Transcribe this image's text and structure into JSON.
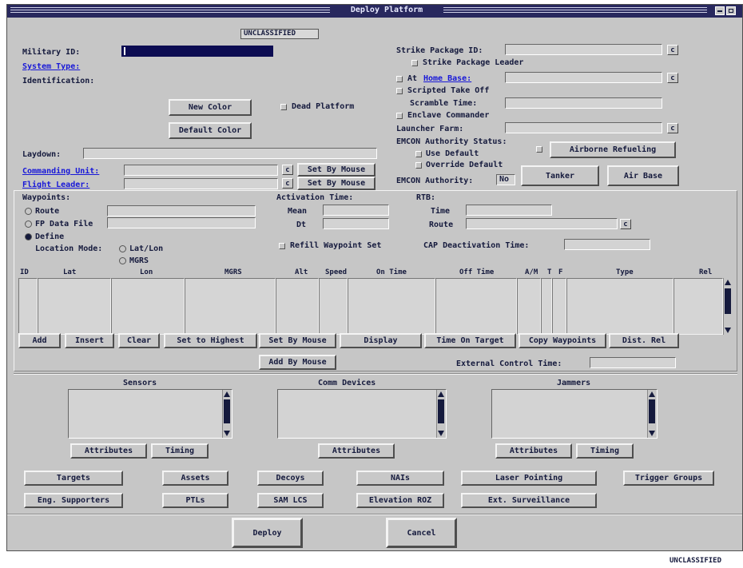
{
  "window": {
    "title": "Deploy Platform",
    "classification_top": "UNCLASSIFIED",
    "classification_bottom": "UNCLASSIFIED",
    "title_bar_color": "#28285e"
  },
  "left_top": {
    "military_id_label": "Military ID:",
    "system_type_label": "System Type:",
    "identification_label": "Identification:",
    "new_color": "New Color",
    "default_color": "Default Color",
    "dead_platform": "Dead Platform",
    "laydown_label": "Laydown:",
    "commanding_unit_label": "Commanding Unit:",
    "flight_leader_label": "Flight Leader:",
    "set_by_mouse_1": "Set By Mouse",
    "set_by_mouse_2": "Set By Mouse",
    "c_btn": "c"
  },
  "right_top": {
    "strike_package_id": "Strike Package ID:",
    "strike_package_leader": "Strike Package Leader",
    "at_label": "At",
    "home_base": "Home Base:",
    "scripted_take_off": "Scripted Take Off",
    "scramble_time": "Scramble Time:",
    "enclave_commander": "Enclave Commander",
    "launcher_farm": "Launcher Farm:",
    "emcon_status": "EMCON Authority Status:",
    "use_default": "Use Default",
    "override_default": "Override Default",
    "emcon_authority": "EMCON Authority:",
    "emcon_value": "No",
    "airborne_refueling": "Airborne Refueling",
    "tanker": "Tanker",
    "air_base": "Air Base"
  },
  "waypoints": {
    "title": "Waypoints:",
    "route": "Route",
    "fp_data_file": "FP Data File",
    "define": "Define",
    "location_mode": "Location Mode:",
    "lat_lon": "Lat/Lon",
    "mgrs": "MGRS",
    "activation_time": "Activation Time:",
    "mean": "Mean",
    "dt": "Dt",
    "rtb": "RTB:",
    "time": "Time",
    "route2": "Route",
    "refill": "Refill Waypoint Set",
    "cap_deactivation": "CAP Deactivation Time:",
    "columns": [
      "ID",
      "Lat",
      "Lon",
      "MGRS",
      "Alt",
      "Speed",
      "On Time",
      "Off Time",
      "A/M",
      "T",
      "F",
      "Type",
      "Rel"
    ],
    "buttons": [
      "Add",
      "Insert",
      "Clear",
      "Set to Highest",
      "Set By Mouse",
      "Display",
      "Time On Target",
      "Copy Waypoints",
      "Dist. Rel"
    ],
    "add_by_mouse": "Add By Mouse",
    "external_control_time": "External Control Time:"
  },
  "devices": {
    "sensors": "Sensors",
    "comm_devices": "Comm Devices",
    "jammers": "Jammers",
    "attributes": "Attributes",
    "timing": "Timing"
  },
  "bottom_buttons": {
    "row1": [
      "Targets",
      "Assets",
      "Decoys",
      "NAIs",
      "Laser Pointing",
      "Trigger Groups"
    ],
    "row2": [
      "Eng. Supporters",
      "PTLs",
      "SAM LCS",
      "Elevation ROZ",
      "Ext. Surveillance"
    ]
  },
  "dialog": {
    "deploy": "Deploy",
    "cancel": "Cancel"
  }
}
